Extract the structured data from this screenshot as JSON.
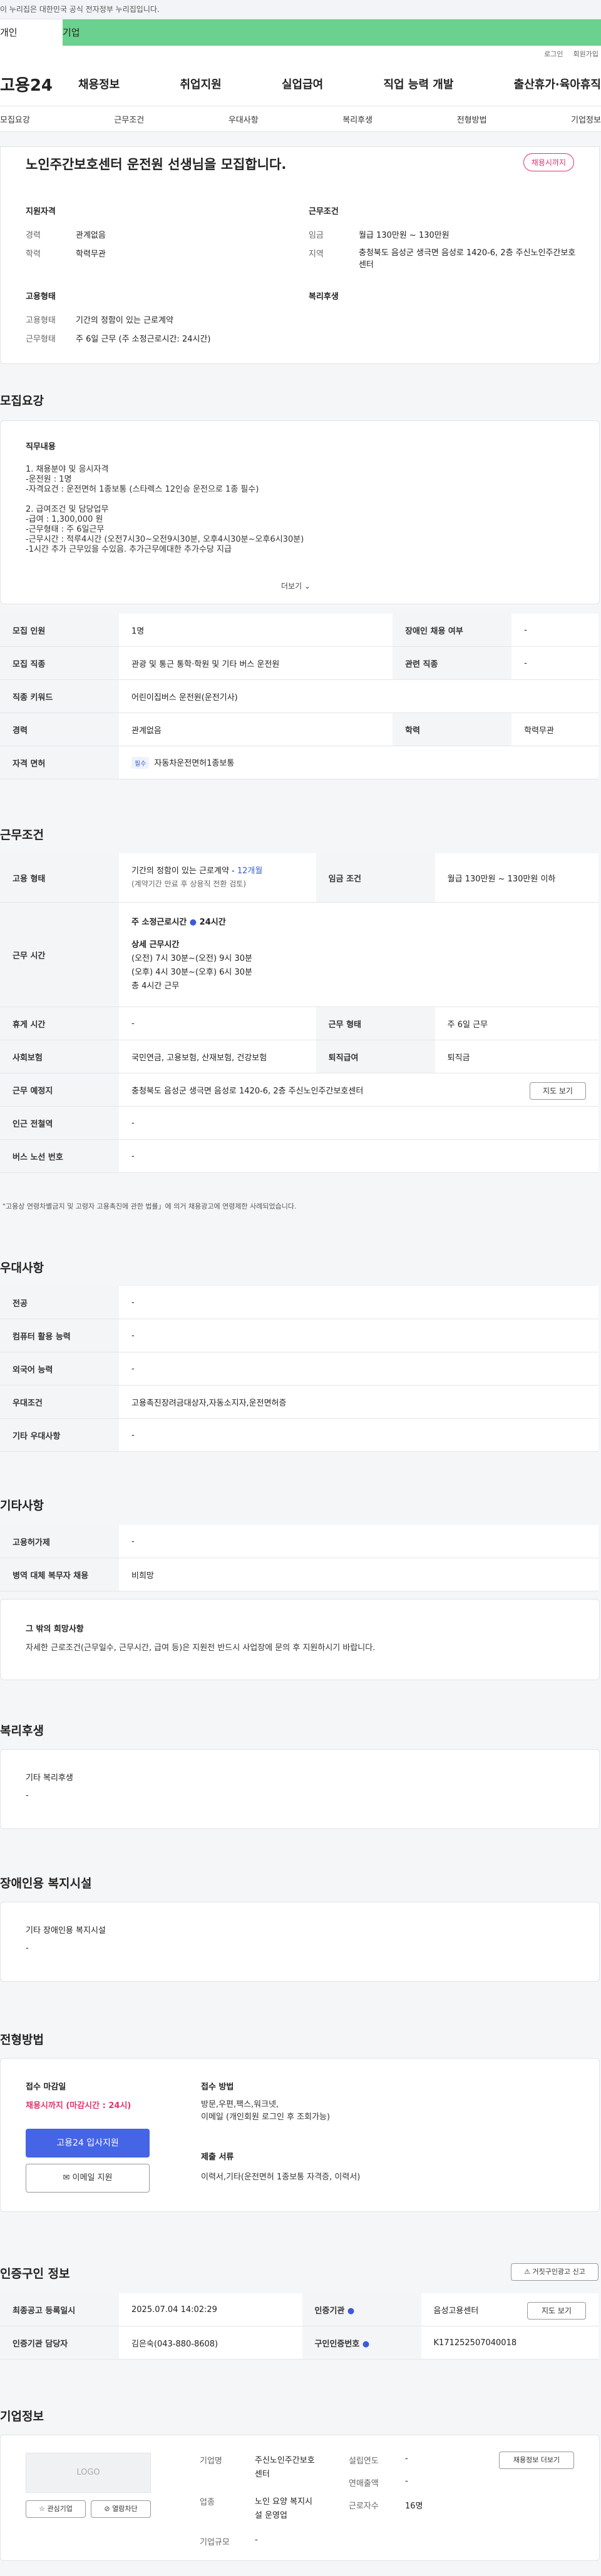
{
  "gov_banner": "이 누리집은 대한민국 공식 전자정부 누리집입니다.",
  "top_tabs": [
    "개인",
    "기업"
  ],
  "utility": [
    "로그인",
    "회원가입"
  ],
  "logo": "고용24",
  "gnb": [
    "채용정보",
    "취업지원",
    "실업급여",
    "직업 능력 개발",
    "출산휴가·육아휴직"
  ],
  "subnav": [
    "모집요강",
    "근무조건",
    "우대사항",
    "복리후생",
    "전형방법",
    "기업정보"
  ],
  "hero": {
    "title": "노인주간보호센터 운전원 선생님을 모집합니다.",
    "badge": "채용시까지",
    "qual_head": "지원자격",
    "cond_head": "근무조건",
    "career_k": "경력",
    "career_v": "관계없음",
    "edu_k": "학력",
    "edu_v": "학력무관",
    "wage_k": "임금",
    "wage_v": "월급 130만원 ~ 130만원",
    "region_k": "지역",
    "region_v": "충청북도 음성군 생극면 음성로 1420-6, 2층 주신노인주간보호센터",
    "type_head": "고용형태",
    "welfare_head": "복리후생",
    "etype_k": "고용형태",
    "etype_v": "기간의 정함이 있는 근로계약",
    "wtype_k": "근무형태",
    "wtype_v": "주 6일 근무 (주 소정근로시간: 24시간)"
  },
  "recruit": {
    "title": "모집요강",
    "duty_head": "직무내용",
    "duty_lines": [
      "1. 채용분야 및 응시자격",
      "-운전원 : 1명",
      "-자격요건 : 운전면허 1종보통 (스타렉스 12인승 운전으로 1종 필수)",
      "",
      "2. 급여조건 및 담당업무",
      "-급여 : 1,300,000 원",
      "-근무형태 : 주 6일근무",
      "-근무시간 : 적루4시간 (오전7시30~오전9시30분, 오후4시30분~오후6시30분)",
      "-1시간 추가 근무있을 수있음. 추가근무에대한 추가수당 지급"
    ],
    "more": "더보기",
    "rows": [
      [
        "모집 인원",
        "1명",
        "장애인 채용 여부",
        "-"
      ],
      [
        "모집 직종",
        "관광 및 통근 통학·학원 및 기타 버스 운전원",
        "관련 직종",
        "-"
      ],
      [
        "직종 키워드",
        "어린이집버스 운전원(운전기사)",
        "",
        ""
      ],
      [
        "경력",
        "관계없음",
        "학력",
        "학력무관"
      ]
    ],
    "license_k": "자격 면허",
    "license_chip": "필수",
    "license_v": "자동차운전면허1종보통"
  },
  "work": {
    "title": "근무조건",
    "etype_k": "고용 형태",
    "etype_v1": "기간의 정함이 있는 근로계약 - ",
    "etype_v1b": "12개월",
    "etype_v2": "(계약기간 만료 후 상용직 전환 검토)",
    "wage_k": "임금 조건",
    "wage_v": "월급 130만원 ~ 130만원 이하",
    "time_k": "근무 시간",
    "time_l1": "주 소정근로시간",
    "time_l1b": "24시간",
    "time_l2": "상세 근무시간",
    "time_l3": "(오전) 7시 30분~(오전) 9시 30분",
    "time_l4": "(오후) 4시 30분~(오후) 6시 30분",
    "time_l5": "총 4시간 근무",
    "rows": [
      [
        "휴게 시간",
        "-",
        "근무 형태",
        "주 6일 근무"
      ],
      [
        "사회보험",
        "국민연금, 고용보험, 산재보험, 건강보험",
        "퇴직급여",
        "퇴직금"
      ]
    ],
    "place_k": "근무 예정지",
    "place_v": "충청북도 음성군 생극면 음성로 1420-6, 2층 주신노인주간보호센터",
    "map_btn": "지도 보기",
    "station_k": "인근 전철역",
    "station_v": "-",
    "bus_k": "버스 노선 번호",
    "bus_v": "-",
    "note": "\"고용상 연령차별금지 및 고령자 고용촉진에 관한 법률」에 의거 채용광고에 연령제한 사례되었습니다."
  },
  "pref": {
    "title": "우대사항",
    "rows": [
      [
        "전공",
        "-"
      ],
      [
        "컴퓨터 활용 능력",
        "-"
      ],
      [
        "외국어 능력",
        "-"
      ],
      [
        "우대조건",
        "고용촉진장려금대상자,자동소지자,운전면허증"
      ],
      [
        "기타 우대사항",
        "-"
      ]
    ]
  },
  "etc": {
    "title": "기타사항",
    "rows": [
      [
        "고용허가제",
        "-"
      ],
      [
        "병역 대체 복무자 채용",
        "비희망"
      ]
    ],
    "box_head": "그 밖의 희망사항",
    "box_text": "자세한 근로조건(근무일수, 근무시간, 급여 등)은 지원전 반드시 사업장에 문의 후 지원하시기 바랍니다."
  },
  "welfare": {
    "title": "복리후생",
    "head": "기타 복리후생",
    "val": "-"
  },
  "disability": {
    "title": "장애인용 복지시설",
    "head": "기타 장애인용 복지시설",
    "val": "-"
  },
  "process": {
    "title": "전형방법",
    "deadline_head": "접수 마감일",
    "deadline_val": "채용시까지 (마감시간 : 24시)",
    "apply_btn": "고용24 입사지원",
    "email_btn": "이메일 지원",
    "method_head": "접수 방법",
    "method_lines": [
      "방문,우편,팩스,워크넷,",
      "이메일 (개인회원 로그인 후 조회가능)"
    ],
    "docs_head": "제출 서류",
    "docs_val": "이력서,기타(운전면허 1종보통 자격증, 이력서)"
  },
  "cert": {
    "title": "인증구인 정보",
    "report_btn": "거짓구인광고 신고",
    "rows": [
      [
        "최종공고 등록일시",
        "2025.07.04 14:02:29",
        "인증기관",
        "음성고용센터"
      ],
      [
        "인증기관 담당자",
        "김은숙(043-880-8608)",
        "구인인증번호",
        "K171252507040018"
      ]
    ],
    "map_btn": "지도 보기"
  },
  "company": {
    "title": "기업정보",
    "logo": "LOGO",
    "fav_btn": "관심기업",
    "block_btn": "열람차단",
    "name_k": "기업명",
    "name_v1": "주신노인주간보호",
    "name_v2": "센터",
    "ind_k": "업종",
    "ind_v1": "노인 요양 복지시",
    "ind_v2": "설 운영업",
    "size_k": "기업규모",
    "size_v": "-",
    "year_k": "설립연도",
    "year_v": "-",
    "sales_k": "연매출액",
    "sales_v": "-",
    "emp_k": "근로자수",
    "emp_v": "16명",
    "jobs_btn": "채용정보 더보기"
  }
}
